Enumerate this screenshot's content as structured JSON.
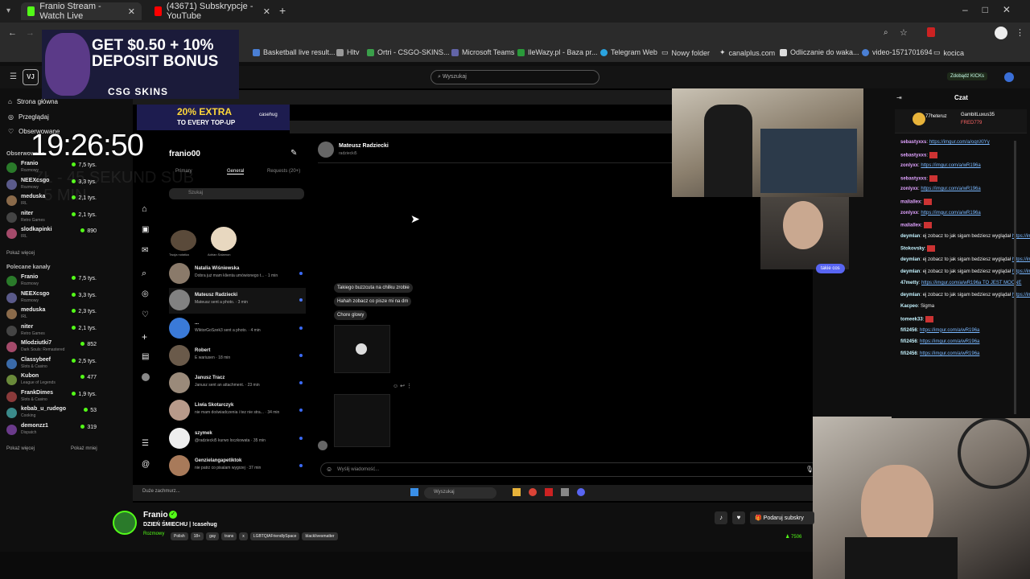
{
  "browser": {
    "tabs": [
      {
        "label": "Franio Stream - Watch Live",
        "active": true,
        "color": "#53fc18"
      },
      {
        "label": "(43671) Subskrypcje - YouTube",
        "active": false,
        "color": "#ff0000"
      }
    ],
    "bookmarks": [
      "Basketball live result...",
      "Hltv",
      "Ortri - CSGO-SKINS...",
      "Microsoft Teams",
      "IleWazy.pl - Baza pr...",
      "Telegram Web",
      "Nowy folder",
      "canalplus.com",
      "Odliczanie do waka...",
      "video-1571701694",
      "kocica"
    ]
  },
  "kick": {
    "logo": "VJ",
    "search_placeholder": "Wyszukaj",
    "subscribe_btn": "Zdobądź KICKs",
    "nav": [
      "Strona główna",
      "Przeglądaj",
      "Obserwowane"
    ],
    "followed_title": "Obserwowane",
    "followed": [
      {
        "name": "Franio",
        "game": "Rozmowy",
        "viewers": "7,5 tys."
      },
      {
        "name": "NEEXcsgo",
        "game": "Rozmowy",
        "viewers": "3,3 tys."
      },
      {
        "name": "meduska",
        "game": "IRL",
        "viewers": "2,1 tys."
      },
      {
        "name": "niter",
        "game": "Retro Games",
        "viewers": "2,1 tys."
      },
      {
        "name": "slodkapinki",
        "game": "IRL",
        "viewers": "890"
      }
    ],
    "show_more": "Pokaż więcej",
    "recommended_title": "Polecane kanały",
    "recommended": [
      {
        "name": "Franio",
        "game": "Rozmowy",
        "viewers": "7,5 tys."
      },
      {
        "name": "NEEXcsgo",
        "game": "Rozmowy",
        "viewers": "3,3 tys."
      },
      {
        "name": "meduska",
        "game": "IRL",
        "viewers": "2,3 tys."
      },
      {
        "name": "niter",
        "game": "Retro Games",
        "viewers": "2,1 tys."
      },
      {
        "name": "Mlodziutki7",
        "game": "Dark Souls: Remastered",
        "viewers": "852"
      },
      {
        "name": "Classybeef",
        "game": "Slots & Casino",
        "viewers": "2,5 tys."
      },
      {
        "name": "Kubon",
        "game": "League of Legends",
        "viewers": "477"
      },
      {
        "name": "FrankDimes",
        "game": "Slots & Casino",
        "viewers": "1,9 tys."
      },
      {
        "name": "kebab_u_rudego",
        "game": "Cooking",
        "viewers": "53"
      },
      {
        "name": "demonzz1",
        "game": "Dispatch",
        "viewers": "319"
      }
    ],
    "show_more2": "Pokaż więcej",
    "show_less": "Pokaż mniej",
    "chat_title": "Czat",
    "chat_top": [
      "77heteruz",
      "GambitLuxus35",
      "FRED779"
    ],
    "chat_messages": [
      {
        "user": "sebastyxxs",
        "color": "#e0a2ff",
        "text": "",
        "link": "https://imgur.com/a/oqnXIYy"
      },
      {
        "user": "sebastyxxs",
        "color": "#e0a2ff",
        "text": "",
        "link": ""
      },
      {
        "user": "zonlyxx",
        "color": "#e0a2ff",
        "text": "",
        "link": "https://imgur.com/a/wR196a"
      },
      {
        "user": "sebastyxxs",
        "color": "#e0a2ff",
        "text": "",
        "link": ""
      },
      {
        "user": "zonlyxx",
        "color": "#e0a2ff",
        "text": "",
        "link": "https://imgur.com/a/wR196a"
      },
      {
        "user": "maliallex",
        "color": "#e0a2ff",
        "text": "",
        "link": ""
      },
      {
        "user": "zonlyxx",
        "color": "#e0a2ff",
        "text": "",
        "link": "https://imgur.com/a/wR196a"
      },
      {
        "user": "maliallex",
        "color": "#e0a2ff",
        "text": "",
        "link": ""
      },
      {
        "user": "deymlan",
        "color": "#c4f3ff",
        "text": "ej zobacz to  jak sigam bedziesz wyglądał",
        "link": "https://imgur.com/a/oqnXIYy"
      },
      {
        "user": "Stokovsky",
        "color": "#c4f3ff",
        "text": "",
        "link": ""
      },
      {
        "user": "deymlan",
        "color": "#c4f3ff",
        "text": "ej zobacz to  jak sigam bedziesz wyglądał",
        "link": "https://imgur.com/a/oqnXIYy"
      },
      {
        "user": "deymlan",
        "color": "#c4f3ff",
        "text": "ej zobacz to  jak sigam bedziesz wyglądał",
        "link": "https://imgur.com/a/oqnXIYy"
      },
      {
        "user": "47metty",
        "color": "#c4f3ff",
        "text": "",
        "link": "https://imgur.com/a/wR196a TO JEST MOCNE"
      },
      {
        "user": "deymlan",
        "color": "#c4f3ff",
        "text": "ej zobacz to  jak sigam bedziesz wyglądał",
        "link": "https://imgur.com/a/oqnXIYy"
      },
      {
        "user": "Kacpeo",
        "color": "#c4f3ff",
        "text": "Sigma",
        "link": ""
      },
      {
        "user": "tomeek33",
        "color": "#c4f3ff",
        "text": "",
        "link": ""
      },
      {
        "user": "fifi2456",
        "color": "#c4f3ff",
        "text": "",
        "link": "https://imgur.com/a/wR196a"
      },
      {
        "user": "fifi2456",
        "color": "#c4f3ff",
        "text": "",
        "link": "https://imgur.com/a/wR196a"
      },
      {
        "user": "fifi2456",
        "color": "#c4f3ff",
        "text": "",
        "link": "https://imgur.com/a/wR196a"
      }
    ],
    "streamer": {
      "name": "Franio",
      "title": "DZIEŃ ŚMIECHU | !casehug",
      "category": "Rozmowy",
      "tags": [
        "Polish",
        "18+",
        "gay",
        "trans",
        "x",
        "LGBTQIAFriendlySpace",
        "blackIivesmatter"
      ],
      "sub_btn": "Podaruj subskry",
      "viewers": "7506"
    }
  },
  "overlay": {
    "clock": "19:26:50",
    "ad_text": "GET $0.50 + 10% DEPOSIT BONUS",
    "ad_brand": "CSG SKINS",
    "ad2_text": "20% EXTRA",
    "ad2_sub": "TO EVERY TOP-UP",
    "ad2_brand": "casehug",
    "faded": "ZŁ - 45 SEKUND SUB - 5 MIN",
    "cam_bubble": "takie cos"
  },
  "instagram": {
    "account": "franio00",
    "tab_primary": "Primary",
    "tab_general": "General",
    "tab_requests": "Requests (20+)",
    "search": "Szukaj",
    "notes": [
      {
        "label": "Twoja notatka"
      },
      {
        "label": "Adrian Salamon"
      }
    ],
    "conversations": [
      {
        "name": "Natalia Wiśniewska",
        "msg": "Dobra już mam klienta umówionego t... · 1 min"
      },
      {
        "name": "Mateusz Radziecki",
        "msg": "Mateusz sent a photo. · 3 min"
      },
      {
        "name": "...",
        "msg": "WiktorGoSzek3 sent a photo. · 4 min"
      },
      {
        "name": "Robert",
        "msg": "E wariusen · 18 min"
      },
      {
        "name": "Janusz Tracz",
        "msg": "Janusz sent an attachment. · 23 min"
      },
      {
        "name": "Liwia Skotarczyk",
        "msg": "nie mam doświadczenia i tez nie stra... · 34 min"
      },
      {
        "name": "szymek",
        "msg": "@radziecki5 kurwo loczkowata · 35 min"
      },
      {
        "name": "Genzielangapetiktok",
        "msg": "nie patrz co pisalam wygrzej · 37 min"
      }
    ],
    "thread_name": "Mateusz Radziecki",
    "thread_user": "radziecki5",
    "bubbles": [
      "Takiego buzzcuta na chilku zrobie",
      "Hahah zobacz co pisze mi na dm",
      "Chore glowy"
    ],
    "composer": "Wyślij wiadomość..."
  },
  "taskbar": {
    "search": "Wyszukaj",
    "weather": "Duże zachmurz..."
  }
}
